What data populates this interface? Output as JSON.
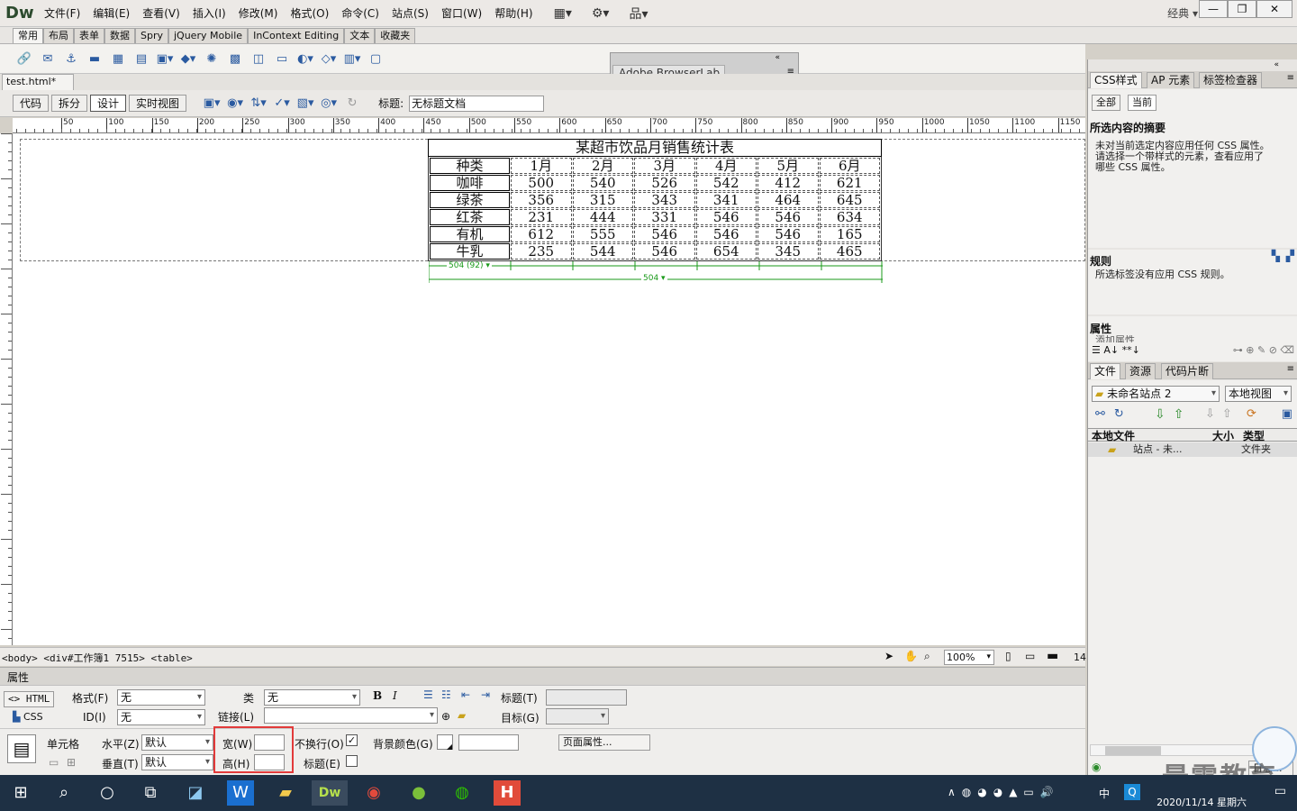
{
  "app": {
    "logo": "Dw",
    "workspace": "经典"
  },
  "menu": [
    "文件(F)",
    "编辑(E)",
    "查看(V)",
    "插入(I)",
    "修改(M)",
    "格式(O)",
    "命令(C)",
    "站点(S)",
    "窗口(W)",
    "帮助(H)"
  ],
  "insert_tabs": [
    "常用",
    "布局",
    "表单",
    "数据",
    "Spry",
    "jQuery Mobile",
    "InContext Editing",
    "文本",
    "收藏夹"
  ],
  "browserlab": {
    "label": "Adobe BrowserLab"
  },
  "doc": {
    "tab_name": "test.html*",
    "tab_close": "×"
  },
  "doc_toolbar": {
    "code": "代码",
    "split": "拆分",
    "design": "设计",
    "live": "实时视图",
    "title_label": "标题:",
    "title_value": "无标题文档"
  },
  "ruler": {
    "top_ticks": [
      "50",
      "100",
      "150",
      "200",
      "250",
      "300",
      "350",
      "400",
      "450",
      "500",
      "550",
      "600",
      "650",
      "700",
      "750",
      "800",
      "850",
      "900",
      "950",
      "1000",
      "1050",
      "1100",
      "1150"
    ]
  },
  "table": {
    "caption": "某超市饮品月销售统计表",
    "header": [
      "种类",
      "1月",
      "2月",
      "3月",
      "4月",
      "5月",
      "6月"
    ],
    "rows": [
      [
        "咖啡",
        "500",
        "540",
        "526",
        "542",
        "412",
        "621"
      ],
      [
        "绿茶",
        "356",
        "315",
        "343",
        "341",
        "464",
        "645"
      ],
      [
        "红茶",
        "231",
        "444",
        "331",
        "546",
        "546",
        "634"
      ],
      [
        "有机",
        "612",
        "555",
        "546",
        "546",
        "546",
        "165"
      ],
      [
        "牛乳",
        "235",
        "544",
        "546",
        "654",
        "345",
        "465"
      ]
    ],
    "col_width_label": "504 (92)",
    "table_width_label": "504"
  },
  "status": {
    "tag_selector": "<body> <div#工作簿1 7515> <table>",
    "zoom": "100%",
    "size": "14"
  },
  "properties": {
    "title": "属性",
    "html_btn": "HTML",
    "css_btn": "CSS",
    "format_label": "格式(F)",
    "format_value": "无",
    "id_label": "ID(I)",
    "id_value": "无",
    "class_label": "类",
    "class_value": "无",
    "link_label": "链接(L)",
    "link_value": "",
    "bold": "B",
    "italic": "I",
    "title_label": "标题(T)",
    "target_label": "目标(G)",
    "cell_label": "单元格",
    "horz_label": "水平(Z)",
    "horz_value": "默认",
    "vert_label": "垂直(T)",
    "vert_value": "默认",
    "width_label": "宽(W)",
    "width_value": "",
    "height_label": "高(H)",
    "height_value": "",
    "nowrap_label": "不换行(O)",
    "header_label": "标题(E)",
    "bgcolor_label": "背景颜色(G)",
    "bgcolor_value": "",
    "page_props": "页面属性..."
  },
  "right_panel": {
    "css_tabs": [
      "CSS样式",
      "AP 元素",
      "标签检查器"
    ],
    "mode_tabs": [
      "全部",
      "当前"
    ],
    "summary_title": "所选内容的摘要",
    "summary_text": [
      "未对当前选定内容应用任何 CSS 属性。",
      "请选择一个带样式的元素，查看应用了",
      "哪些 CSS 属性。"
    ],
    "rules_title": "规则",
    "rules_text": "所选标签没有应用 CSS 规则。",
    "props_title": "属性",
    "props_add": "添加属性",
    "file_tabs": [
      "文件",
      "资源",
      "代码片断"
    ],
    "site_name": "未命名站点 2",
    "view_name": "本地视图",
    "cols": [
      "本地文件",
      "大小",
      "类型"
    ],
    "file_row": {
      "name": "站点 - 未...",
      "type": "文件夹"
    },
    "log_btn": "日志..."
  },
  "taskbar": {
    "datetime": "2020/11/14 星期六",
    "ime": "中"
  },
  "watermark": "最需教育",
  "colors": {
    "accent_green": "#1a9a1a",
    "highlight_red": "#e23a3a",
    "taskbar": "#1e3044"
  }
}
